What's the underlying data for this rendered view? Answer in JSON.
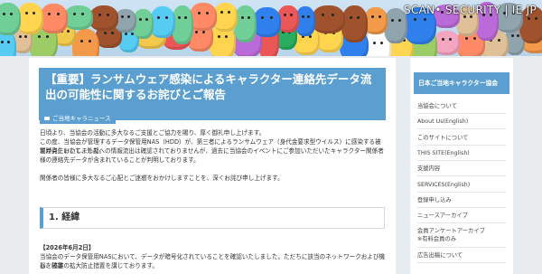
{
  "watermark": "SCAN• SECURITY | IE JP",
  "article": {
    "title": "【重要】ランサムウェア感染によるキャラクター連絡先データ流出の可能性に関するお詫びとご報告",
    "category": "ご当地キャラニュース",
    "p1": "日頃より、当協会の活動に多大なるご支援とご協力を賜り、厚く御礼申し上げます。",
    "p2": "この度、当協会が管理するデータ保管用NAS（HDD）が、第三者によるランサムウェア（身代金要求型ウイルス）に感染する被害が発生いたしました。",
    "p3": "現時点において、外部への情報流出は確認されておりませんが、過去に当協会のイベントにご参加いただいたキャラクター関係者様の連絡先データが含まれていることが判明しております。",
    "p4": "関係者の皆様に多大なるご心配とご迷惑をおかけしますことを、深くお詫び申し上げます。",
    "section_title": "1. 経緯",
    "date_line": "【2026年6月2日】",
    "p5": "当協会のデータ保管用NASにおいて、データが暗号化されていることを確認いたしました。ただちに該当のネットワークおよび機器を隔離",
    "p6": "し、被害の拡大防止措置を講じております。"
  },
  "sidebar": {
    "heading": "日本ご当地キャラクター協会",
    "items": [
      {
        "label": "当協会について"
      },
      {
        "label": "About Us(English)"
      },
      {
        "label": "このサイトについて"
      },
      {
        "label": "THIS SITE(English)"
      },
      {
        "label": "支援内容"
      },
      {
        "label": "SERVICES(English)"
      },
      {
        "label": "登録申し込み"
      },
      {
        "label": "ニュースアーカイブ"
      },
      {
        "label": "会員アンケートアーカイブ",
        "sub": "※有料会員のみ"
      },
      {
        "label": "広告出稿について"
      }
    ]
  },
  "colors": {
    "accent": "#5b9fd1",
    "background": "#e9ecef"
  }
}
